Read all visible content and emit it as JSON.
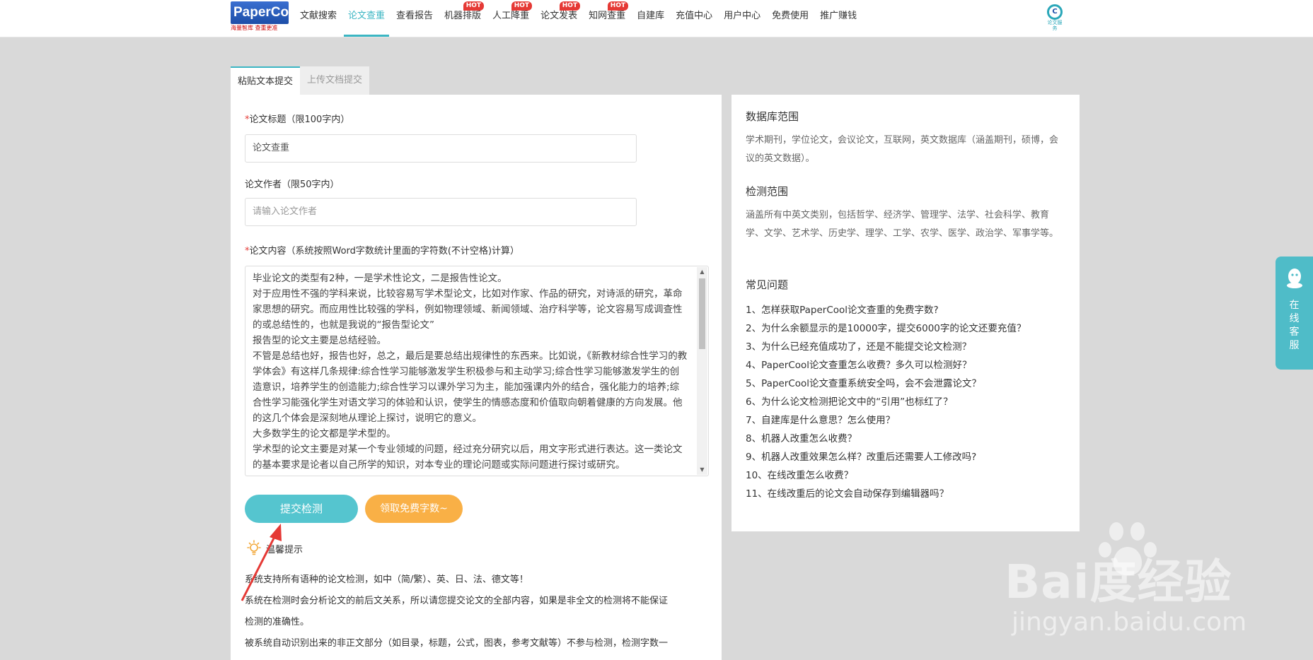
{
  "header": {
    "logo_text": "PaperCool",
    "logo_slogan": "海量智库 查重更准",
    "nav": [
      {
        "label": "文献搜索",
        "hot": ""
      },
      {
        "label": "论文查重",
        "hot": ""
      },
      {
        "label": "查看报告",
        "hot": ""
      },
      {
        "label": "机器排版",
        "hot": "HOT"
      },
      {
        "label": "人工降重",
        "hot": "HOT"
      },
      {
        "label": "论文发表",
        "hot": "HOT"
      },
      {
        "label": "知网查重",
        "hot": "HOT"
      },
      {
        "label": "自建库",
        "hot": ""
      },
      {
        "label": "充值中心",
        "hot": ""
      },
      {
        "label": "用户中心",
        "hot": ""
      },
      {
        "label": "免费使用",
        "hot": ""
      },
      {
        "label": "推广赚钱",
        "hot": ""
      }
    ],
    "active_nav_index": 1,
    "corner_logo_caption": "论文服务",
    "corner_logo_mark": "C"
  },
  "tabs": {
    "paste": "粘贴文本提交",
    "upload": "上传文档提交"
  },
  "form": {
    "required_mark": "*",
    "title_label": "论文标题（限100字内）",
    "title_value": "论文查重",
    "author_label": "论文作者（限50字内）",
    "author_placeholder": "请输入论文作者",
    "content_label": "论文内容（系统按照Word字数统计里面的字符数(不计空格)计算）",
    "content_lines": [
      "毕业论文的类型有2种，一是学术性论文，二是报告性论文。",
      "对于应用性不强的学科来说，比较容易写学术型论文，比如对作家、作品的研究，对诗派的研究，革命家思想的研究。而应用性比较强的学科，例如物理领域、新闻领域、治疗科学等，论文容易写成调查性的或总结性的，也就是我说的“报告型论文”",
      "报告型的论文主要是总结经验。",
      "不管是总结也好，报告也好，总之，最后是要总结出规律性的东西来。比如说，《新教材综合性学习的教学体会》有这样几条规律:综合性学习能够激发学生积极参与和主动学习;综合性学习能够激发学生的创造意识，培养学生的创造能力;综合性学习以课外学习为主，能加强课内外的结合，强化能力的培养;综合性学习能强化学生对语文学习的体验和认识，使学生的情感态度和价值取向朝着健康的方向发展。他的这几个体会是深刻地从理论上探讨，说明它的意义。",
      "大多数学生的论文都是学术型的。",
      "学术型的论文主要是对某一个专业领域的问题，经过充分研究以后，用文字形式进行表达。这一类论文的基本要求是论者以自己所学的知识，对本专业的理论问题或实际问题进行探讨或研究。"
    ],
    "submit_label": "提交检测",
    "free_label": "领取免费字数~"
  },
  "tips": {
    "title": "温馨提示",
    "lines": [
      "系统支持所有语种的论文检测，如中（简/繁）、英、日、法、德文等！",
      "系统在检测时会分析论文的前后文关系，所以请您提交论文的全部内容，如果是非全文的检测将不能保证",
      "检测的准确性。",
      "被系统自动识别出来的非正文部分（如目录，标题，公式，图表，参考文献等）不参与检测，检测字数一"
    ]
  },
  "info": {
    "db_title": "数据库范围",
    "db_text": "学术期刊，学位论文，会议论文，互联网，英文数据库（涵盖期刊，硕博，会议的英文数据）。",
    "scope_title": "检测范围",
    "scope_text": "涵盖所有中英文类别，包括哲学、经济学、管理学、法学、社会科学、教育学、文学、艺术学、历史学、理学、工学、农学、医学、政治学、军事学等。",
    "faq_title": "常见问题",
    "faq": [
      "1、怎样获取PaperCool论文查重的免费字数?",
      "2、为什么余额显示的是10000字，提交6000字的论文还要充值？",
      "3、为什么已经充值成功了，还是不能提交论文检测？",
      "4、PaperCool论文查重怎么收费？多久可以检测好？",
      "5、PaperCool论文查重系统安全吗，会不会泄露论文？",
      "6、为什么论文检测把论文中的“引用”也标红了？",
      "7、自建库是什么意思？怎么使用？",
      "8、机器人改重怎么收费？",
      "9、机器人改重效果怎么样？改重后还需要人工修改吗?",
      "10、在线改重怎么收费？",
      "11、在线改重后的论文会自动保存到编辑器吗？"
    ]
  },
  "kefu": {
    "label": "在线客服"
  },
  "watermark": {
    "main": "Bai度经验",
    "sub": "jingyan.baidu.com"
  },
  "colors": {
    "accent": "#3bb6c3",
    "submit": "#55c5cf",
    "free": "#f9b046",
    "hot": "#e53935",
    "arrow": "#e53935"
  }
}
